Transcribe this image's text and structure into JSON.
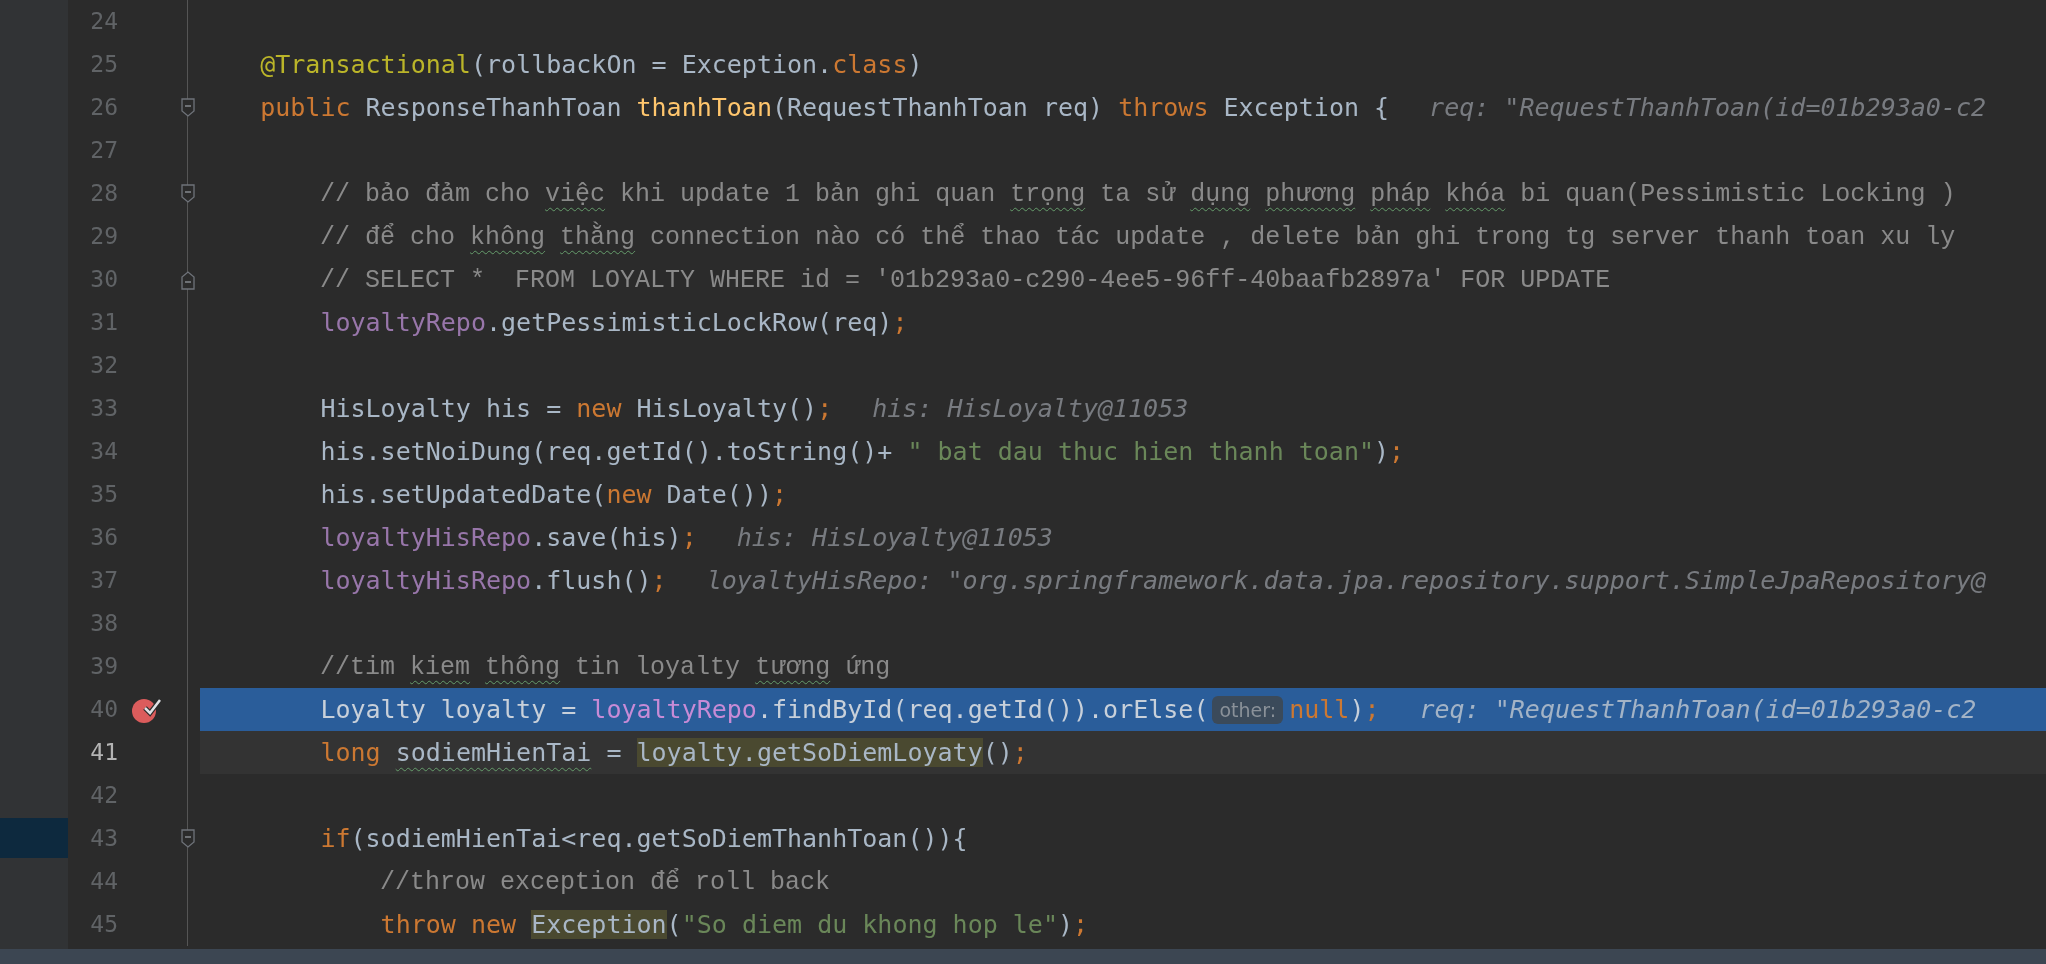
{
  "editor": {
    "lines": [
      {
        "number": "24",
        "kind": "code",
        "breakpoint": false,
        "execution_point": false,
        "current": false
      },
      {
        "number": "25",
        "kind": "code",
        "breakpoint": false,
        "execution_point": false,
        "current": false,
        "tokens": [
          {
            "text": "    @Transactional",
            "kind": "annotation"
          },
          {
            "text": "(rollbackOn = Exception.",
            "kind": "plain"
          },
          {
            "text": "class",
            "kind": "keyword"
          },
          {
            "text": ")",
            "kind": "plain"
          }
        ]
      },
      {
        "number": "26",
        "kind": "fold_start",
        "breakpoint": false,
        "execution_point": false,
        "current": false,
        "tokens": [
          {
            "text": "    public",
            "kind": "keyword"
          },
          {
            "text": " ResponseThanhToan ",
            "kind": "plain"
          },
          {
            "text": "thanhToan",
            "kind": "method"
          },
          {
            "text": "(RequestThanhToan req) ",
            "kind": "plain"
          },
          {
            "text": "throws",
            "kind": "keyword"
          },
          {
            "text": " Exception {",
            "kind": "plain"
          },
          {
            "text": "req: \"RequestThanhToan(id=01b293a0-c2",
            "kind": "hint"
          }
        ]
      },
      {
        "number": "27",
        "kind": "code",
        "breakpoint": false,
        "execution_point": false,
        "current": false
      },
      {
        "number": "28",
        "kind": "fold_start",
        "breakpoint": false,
        "execution_point": false,
        "current": false,
        "tokens": [
          {
            "text": "        // bảo đảm cho ",
            "kind": "comment"
          },
          {
            "text": "việc",
            "kind": "comment",
            "typo": true
          },
          {
            "text": " khi update 1 bản ghi quan ",
            "kind": "comment"
          },
          {
            "text": "trọng",
            "kind": "comment",
            "typo": true
          },
          {
            "text": " ta sử ",
            "kind": "comment"
          },
          {
            "text": "dụng ",
            "kind": "comment",
            "typo": true
          },
          {
            "text": "phương ",
            "kind": "comment",
            "typo": true
          },
          {
            "text": "pháp ",
            "kind": "comment",
            "typo": true
          },
          {
            "text": "khóa",
            "kind": "comment",
            "typo": true
          },
          {
            "text": " bi quan(Pessimistic Locking )",
            "kind": "comment"
          }
        ]
      },
      {
        "number": "29",
        "kind": "code",
        "breakpoint": false,
        "execution_point": false,
        "current": false,
        "tokens": [
          {
            "text": "        // để cho ",
            "kind": "comment"
          },
          {
            "text": "không ",
            "kind": "comment",
            "typo": true
          },
          {
            "text": "thằng",
            "kind": "comment",
            "typo": true
          },
          {
            "text": " connection nào có thể thao tác update , delete bản ghi trong tg server thanh toan xu ly",
            "kind": "comment"
          }
        ]
      },
      {
        "number": "30",
        "kind": "fold_end",
        "breakpoint": false,
        "execution_point": false,
        "current": false,
        "tokens": [
          {
            "text": "        // SELECT *  FROM LOYALTY WHERE id = '01b293a0-c290-4ee5-96ff-40baafb2897a' FOR UPDATE",
            "kind": "comment"
          }
        ]
      },
      {
        "number": "31",
        "kind": "code",
        "breakpoint": false,
        "execution_point": false,
        "current": false,
        "tokens": [
          {
            "text": "        loyaltyRepo",
            "kind": "field"
          },
          {
            "text": ".getPessimisticLockRow(req)",
            "kind": "plain"
          },
          {
            "text": ";",
            "kind": "keyword"
          }
        ]
      },
      {
        "number": "32",
        "kind": "code",
        "breakpoint": false,
        "execution_point": false,
        "current": false
      },
      {
        "number": "33",
        "kind": "code",
        "breakpoint": false,
        "execution_point": false,
        "current": false,
        "tokens": [
          {
            "text": "        HisLoyalty his = ",
            "kind": "plain"
          },
          {
            "text": "new",
            "kind": "keyword"
          },
          {
            "text": " HisLoyalty()",
            "kind": "plain"
          },
          {
            "text": ";",
            "kind": "keyword"
          },
          {
            "text": "his: HisLoyalty@11053",
            "kind": "hint"
          }
        ]
      },
      {
        "number": "34",
        "kind": "code",
        "breakpoint": false,
        "execution_point": false,
        "current": false,
        "tokens": [
          {
            "text": "        his.setNoiDung(req.getId().toString()+ ",
            "kind": "plain"
          },
          {
            "text": "\" bat dau thuc hien thanh toan\"",
            "kind": "string"
          },
          {
            "text": ")",
            "kind": "plain"
          },
          {
            "text": ";",
            "kind": "keyword"
          }
        ]
      },
      {
        "number": "35",
        "kind": "code",
        "breakpoint": false,
        "execution_point": false,
        "current": false,
        "tokens": [
          {
            "text": "        his.setUpdatedDate(",
            "kind": "plain"
          },
          {
            "text": "new",
            "kind": "keyword"
          },
          {
            "text": " Date())",
            "kind": "plain"
          },
          {
            "text": ";",
            "kind": "keyword"
          }
        ]
      },
      {
        "number": "36",
        "kind": "code",
        "breakpoint": false,
        "execution_point": false,
        "current": false,
        "tokens": [
          {
            "text": "        loyaltyHisRepo",
            "kind": "field"
          },
          {
            "text": ".save(his)",
            "kind": "plain"
          },
          {
            "text": ";",
            "kind": "keyword"
          },
          {
            "text": "his: HisLoyalty@11053",
            "kind": "hint"
          }
        ]
      },
      {
        "number": "37",
        "kind": "code",
        "breakpoint": false,
        "execution_point": false,
        "current": false,
        "tokens": [
          {
            "text": "        loyaltyHisRepo",
            "kind": "field"
          },
          {
            "text": ".flush()",
            "kind": "plain"
          },
          {
            "text": ";",
            "kind": "keyword"
          },
          {
            "text": "loyaltyHisRepo: \"org.springframework.data.jpa.repository.support.SimpleJpaRepository@",
            "kind": "hint"
          }
        ]
      },
      {
        "number": "38",
        "kind": "code",
        "breakpoint": false,
        "execution_point": false,
        "current": false
      },
      {
        "number": "39",
        "kind": "code",
        "breakpoint": false,
        "execution_point": false,
        "current": false,
        "tokens": [
          {
            "text": "        //tim ",
            "kind": "comment"
          },
          {
            "text": "kiem ",
            "kind": "comment",
            "typo": true
          },
          {
            "text": "thông",
            "kind": "comment",
            "typo": true
          },
          {
            "text": " tin loyalty ",
            "kind": "comment"
          },
          {
            "text": "tương",
            "kind": "comment",
            "typo": true
          },
          {
            "text": " ứng",
            "kind": "comment"
          }
        ]
      },
      {
        "number": "40",
        "kind": "code",
        "breakpoint": true,
        "execution_point": true,
        "current": false,
        "tokens": [
          {
            "text": "        Loyalty loyalty = ",
            "kind": "plain"
          },
          {
            "text": "loyaltyRepo",
            "kind": "field"
          },
          {
            "text": ".findById(req.getId()).orElse(",
            "kind": "plain"
          },
          {
            "text": "other:",
            "kind": "param"
          },
          {
            "text": "null",
            "kind": "keyword"
          },
          {
            "text": ")",
            "kind": "plain"
          },
          {
            "text": ";",
            "kind": "keyword"
          },
          {
            "text": "req: \"RequestThanhToan(id=01b293a0-c2",
            "kind": "hint"
          }
        ]
      },
      {
        "number": "41",
        "kind": "code",
        "breakpoint": false,
        "execution_point": false,
        "current": true,
        "tokens": [
          {
            "text": "        long ",
            "kind": "keyword"
          },
          {
            "text": "sodiemHienTai",
            "kind": "plain",
            "typo": true
          },
          {
            "text": " = ",
            "kind": "plain"
          },
          {
            "text": "loyalty.getSoDiemLoyaty",
            "kind": "plain",
            "highlighted": true
          },
          {
            "text": "()",
            "kind": "plain"
          },
          {
            "text": ";",
            "kind": "keyword"
          }
        ]
      },
      {
        "number": "42",
        "kind": "code",
        "breakpoint": false,
        "execution_point": false,
        "current": false
      },
      {
        "number": "43",
        "kind": "fold_start",
        "breakpoint": false,
        "execution_point": false,
        "current": false,
        "tokens": [
          {
            "text": "        if",
            "kind": "keyword"
          },
          {
            "text": "(sodiemHienTai<req.getSoDiemThanhToan()){",
            "kind": "plain"
          }
        ]
      },
      {
        "number": "44",
        "kind": "code",
        "breakpoint": false,
        "execution_point": false,
        "current": false,
        "tokens": [
          {
            "text": "            //throw exception để roll back",
            "kind": "comment"
          }
        ]
      },
      {
        "number": "45",
        "kind": "code",
        "breakpoint": false,
        "execution_point": false,
        "current": false,
        "tokens": [
          {
            "text": "            throw new ",
            "kind": "keyword"
          },
          {
            "text": "Exception",
            "kind": "plain",
            "highlighted": true
          },
          {
            "text": "(",
            "kind": "plain"
          },
          {
            "text": "\"So diem du khong hop le\"",
            "kind": "string"
          },
          {
            "text": ")",
            "kind": "plain"
          },
          {
            "text": ";",
            "kind": "keyword"
          }
        ]
      }
    ]
  }
}
